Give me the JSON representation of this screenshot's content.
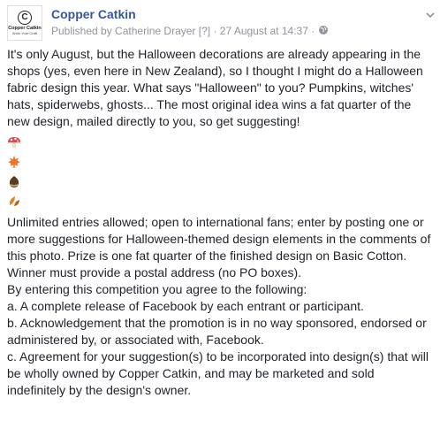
{
  "post": {
    "page_name": "Copper Catkin",
    "logo": {
      "letter": "C",
      "name": "Copper Catkin",
      "tagline": "Work Your Craft"
    },
    "meta": {
      "published_by": "Published by Catherine Drayer",
      "help": "[?]",
      "separator": "·",
      "timestamp": "27 August at 14:37",
      "separator2": "·"
    },
    "intro": "It's only August, but the Halloween decorations are already appearing in the shops (yes, even here in New Zealand), so I thought I might do a Halloween fabric design this year. What says \"Halloween\" to you? Pumpkins, witches' hats, spiderwebs, ghosts... The most original idea wins a fat quarter of the new design, mailed directly to you, so get suggesting!",
    "emojis": [
      "mushroom-icon",
      "maple-leaf-icon",
      "chestnut-icon",
      "fallen-leaf-icon"
    ],
    "rules": [
      "Unlimited entries allowed; open to international fans; enter by posting one or more suggestions for Halloween-themed design elements in the comments of this photo. Prize is one fat quarter of the finished design on Basic Cotton. Winner must provide a postal address (no PO boxes).",
      "By entering this competition you agree to the following:",
      "a. A complete release of Facebook by each entrant or participant.",
      "b. Acknowledgement that the promotion is in no way sponsored, endorsed or administered by, or associated with, Facebook.",
      "c. Agreement for your suggestion(s) to be incorporated into design(s) that will be wholly owned by Copper Catkin, and may be marketed and sold indefinitely by the design's owner."
    ]
  },
  "colors": {
    "link": "#365899",
    "meta": "#90949c",
    "text": "#1d2129"
  }
}
